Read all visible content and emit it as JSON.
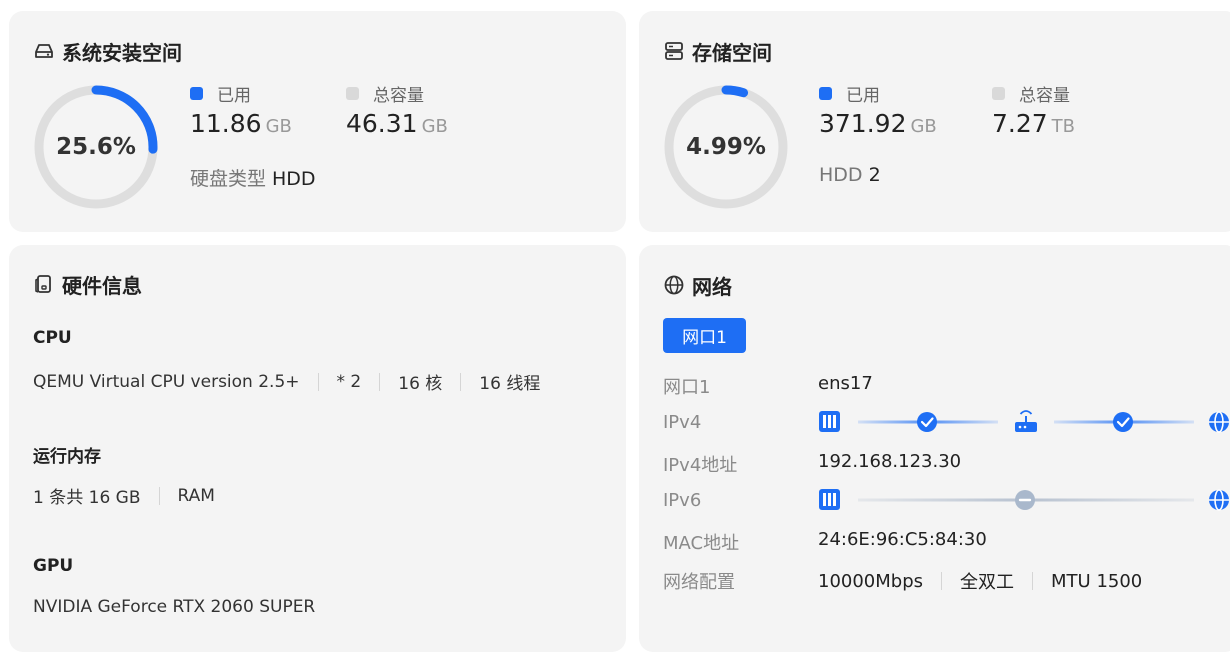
{
  "colors": {
    "accent": "#1e6ef4",
    "ring_track": "#dedede",
    "ok": "#1e6ef4",
    "idle": "#a9b8cc"
  },
  "system_disk": {
    "title": "系统安装空间",
    "icon": "hard-drive-icon",
    "percent_text": "25.6%",
    "percent": 25.6,
    "used_label": "已用",
    "used_value": "11.86",
    "used_unit": "GB",
    "total_label": "总容量",
    "total_value": "46.31",
    "total_unit": "GB",
    "disk_type_label": "硬盘类型",
    "disk_type_value": "HDD"
  },
  "storage": {
    "title": "存储空间",
    "icon": "server-icon",
    "percent_text": "4.99%",
    "percent": 4.99,
    "used_label": "已用",
    "used_value": "371.92",
    "used_unit": "GB",
    "total_label": "总容量",
    "total_value": "7.27",
    "total_unit": "TB",
    "hdd_label": "HDD",
    "hdd_value": "2"
  },
  "hardware": {
    "title": "硬件信息",
    "icon": "device-icon",
    "cpu_label": "CPU",
    "cpu_model": "QEMU Virtual CPU version 2.5+",
    "cpu_count": "* 2",
    "cpu_cores": "16 核",
    "cpu_threads": "16 线程",
    "mem_label": "运行内存",
    "mem_desc": "1 条共 16 GB",
    "mem_type": "RAM",
    "gpu_label": "GPU",
    "gpu_model": "NVIDIA GeForce RTX 2060 SUPER"
  },
  "network": {
    "title": "网络",
    "icon": "globe-icon",
    "tab_label": "网口1",
    "rows": {
      "port_label": "网口1",
      "port_value": "ens17",
      "ipv4_label": "IPv4",
      "ipv4_addr_label": "IPv4地址",
      "ipv4_addr_value": "192.168.123.30",
      "ipv6_label": "IPv6",
      "mac_label": "MAC地址",
      "mac_value": "24:6E:96:C5:84:30",
      "config_label": "网络配置",
      "speed": "10000Mbps",
      "duplex": "全双工",
      "mtu": "MTU 1500"
    }
  }
}
